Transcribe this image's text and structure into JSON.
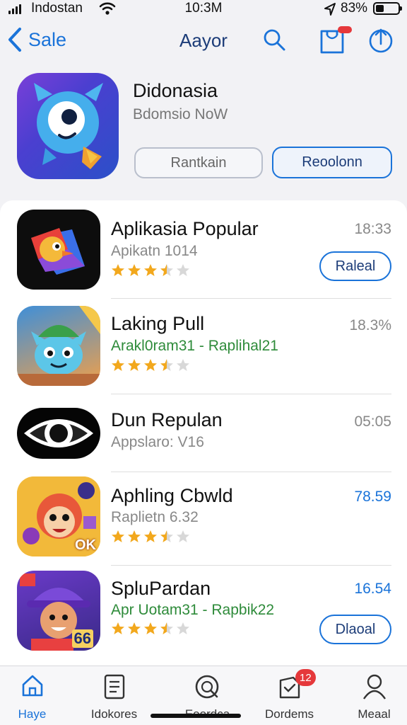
{
  "status_bar": {
    "carrier": "Indostan",
    "time": "10:3M",
    "battery": "83%",
    "icons": [
      "signal-icon",
      "wifi-icon",
      "location-arrow-icon",
      "battery-icon"
    ]
  },
  "nav": {
    "back_label": "Sale",
    "title": "Aayor",
    "icons": [
      "search-icon",
      "bag-icon",
      "share-icon"
    ]
  },
  "featured": {
    "name": "Didonasia",
    "subtitle": "Bdomsio NoW",
    "button_secondary": "Rantkain",
    "button_primary": "Reoolonn"
  },
  "apps": [
    {
      "name": "Aplikasia Popular",
      "meta": "Apikatn 1014",
      "right_value": "18:33",
      "button": "Raleal",
      "rating": 3.5
    },
    {
      "name": "Laking Pull",
      "meta": "Arakl0ram31 - Raplihal21",
      "right_value": "18.3%",
      "rating": 3.5
    },
    {
      "name": "Dun Repulan",
      "meta": "Appslaro: V16",
      "right_value": "05:05"
    },
    {
      "name": "Aphling Cbwld",
      "meta": "Raplietn 6.32",
      "right_value": "78.59",
      "rating": 3.5
    },
    {
      "name": "SpluPardan",
      "meta": "Apr Uotam31 - Rapbik22",
      "right_value": "16.54",
      "button": "Dlaoal",
      "rating": 3.5
    }
  ],
  "icon_labels": {
    "app4": "OK",
    "app5": "66"
  },
  "tab_bar": [
    {
      "label": "Haye",
      "icon": "house-icon",
      "active": true
    },
    {
      "label": "Idokores",
      "icon": "document-icon"
    },
    {
      "label": "Eoordca",
      "icon": "search-icon"
    },
    {
      "label": "Dordems",
      "icon": "box-icon",
      "badge": "12"
    },
    {
      "label": "Meaal",
      "icon": "person-icon"
    }
  ],
  "colors": {
    "accent": "#1a73d9",
    "title_blue": "#1c3c78",
    "star": "#f2a81d",
    "badge": "#e5383b",
    "green_meta": "#2e8b3a"
  }
}
